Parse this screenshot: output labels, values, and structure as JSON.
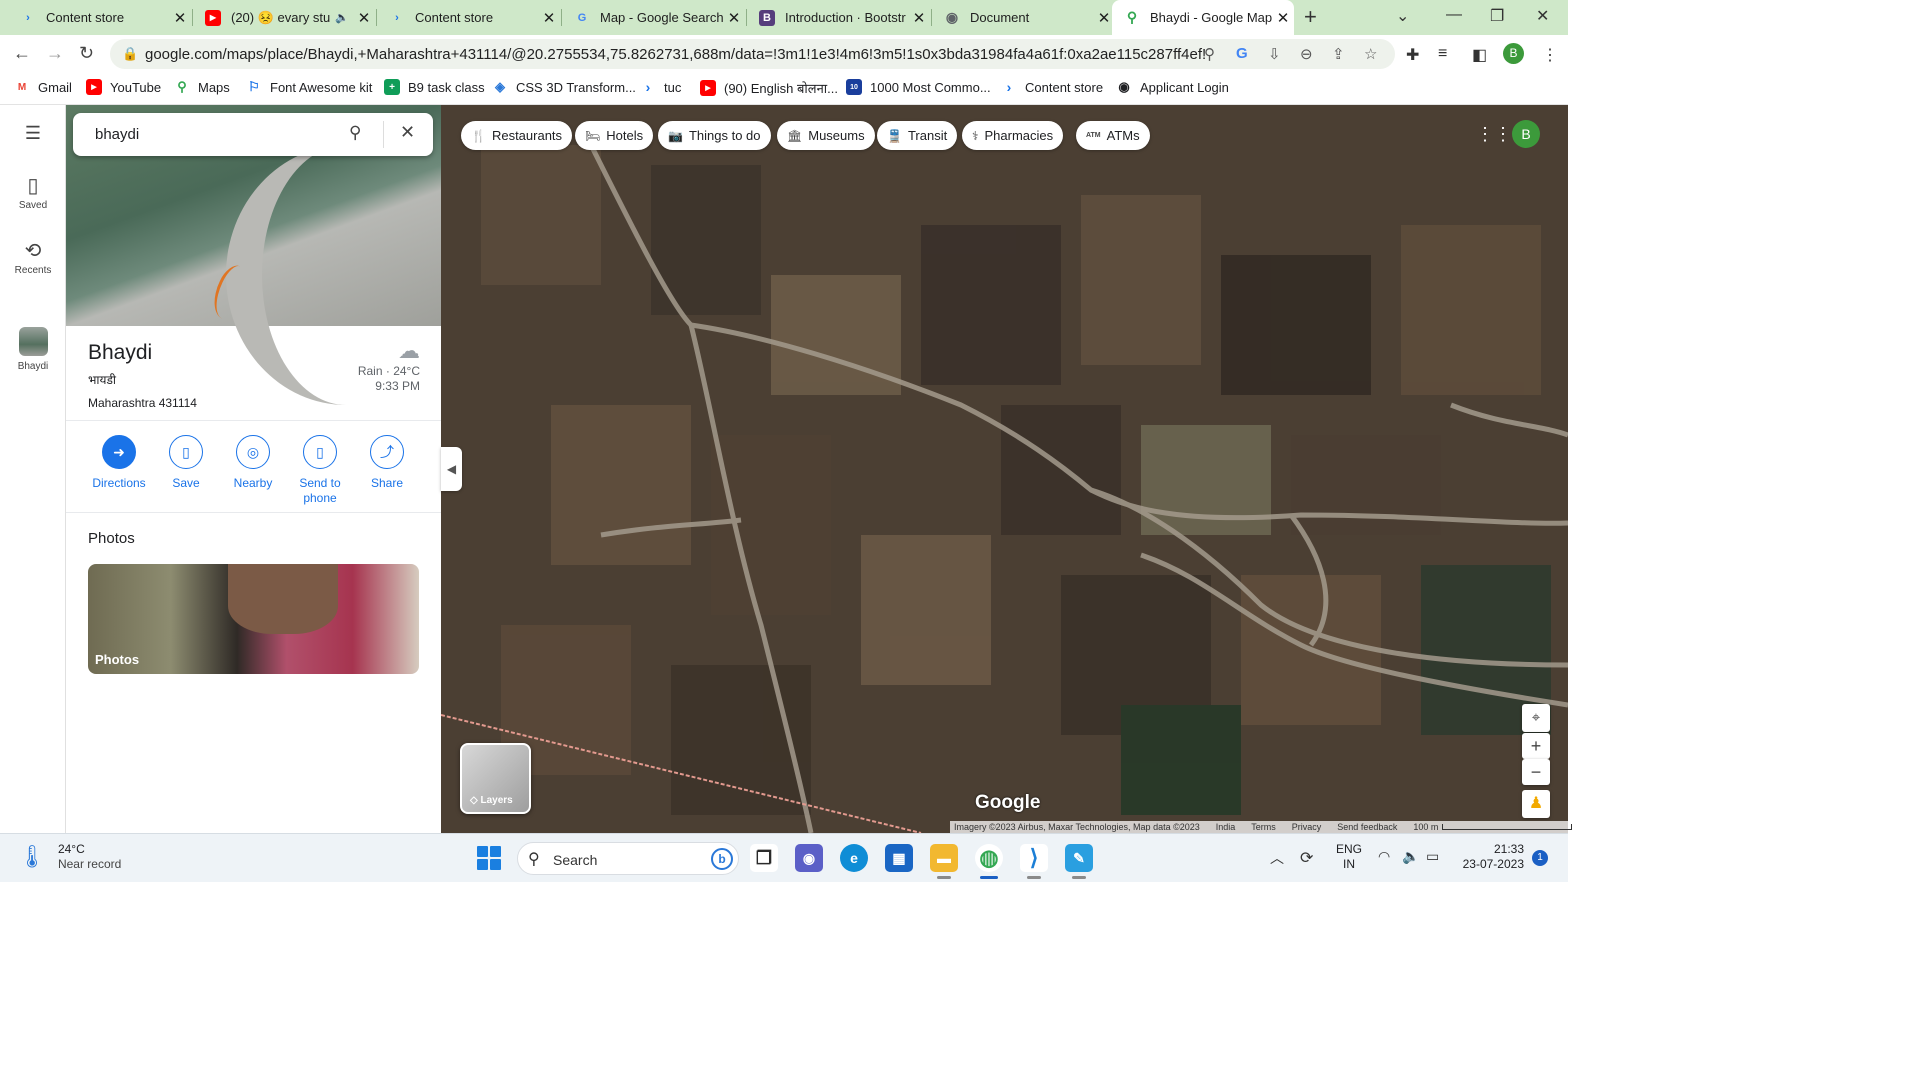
{
  "browser": {
    "tabs": [
      {
        "title": "Content store",
        "favicon": "content-store-icon",
        "color": "#1a73e8"
      },
      {
        "title": "(20) 😣 evary stu",
        "favicon": "youtube-icon",
        "color": "#ff0000",
        "audio": "🔈"
      },
      {
        "title": "Content store",
        "favicon": "content-store-icon",
        "color": "#1a73e8"
      },
      {
        "title": "Map - Google Search",
        "favicon": "google-icon",
        "color": "#4285f4"
      },
      {
        "title": "Introduction · Bootstr",
        "favicon": "bootstrap-icon",
        "color": "#563d7c"
      },
      {
        "title": "Document",
        "favicon": "globe-icon",
        "color": "#5f6368"
      },
      {
        "title": "Bhaydi - Google Map",
        "favicon": "google-maps-icon",
        "color": "#34a853"
      }
    ],
    "new_tab": "+",
    "url": "google.com/maps/place/Bhaydi,+Maharashtra+431114/@20.2755534,75.8262731,688m/data=!3m1!1e3!4m6!3m5!1s0x3bda31984fa4a61f:0xa2ae115c287ff4ef!8m2!...",
    "profile_initial": "B",
    "bookmarks": [
      {
        "label": "Gmail",
        "icon": "gmail-icon",
        "color": "#ea4335",
        "glyph": "M"
      },
      {
        "label": "YouTube",
        "icon": "youtube-icon",
        "color": "#ff0000",
        "glyph": "▶"
      },
      {
        "label": "Maps",
        "icon": "maps-icon",
        "color": "#34a853",
        "glyph": "⚲"
      },
      {
        "label": "Font Awesome kit",
        "icon": "flag-icon",
        "color": "#1a73e8",
        "glyph": "⚐"
      },
      {
        "label": "B9 task class",
        "icon": "plus-square-icon",
        "color": "#0f9d58",
        "glyph": "+"
      },
      {
        "label": "CSS 3D Transform...",
        "icon": "layers-icon",
        "color": "#2a78d8",
        "glyph": "◈"
      },
      {
        "label": "tuc",
        "icon": "content-store-icon",
        "color": "#1a73e8",
        "glyph": "›"
      },
      {
        "label": "(90) English बोलना...",
        "icon": "youtube-icon",
        "color": "#ff0000",
        "glyph": "▶"
      },
      {
        "label": "1000 Most Commo...",
        "icon": "calendar-icon",
        "color": "#1a3e9c",
        "glyph": "10"
      },
      {
        "label": "Content store",
        "icon": "content-store-icon",
        "color": "#1a73e8",
        "glyph": "›"
      },
      {
        "label": "Applicant Login",
        "icon": "globe-icon",
        "color": "#202124",
        "glyph": "◉"
      }
    ]
  },
  "maps": {
    "rail": [
      {
        "label": "Saved",
        "icon": "bookmark-icon",
        "glyph": "🔖"
      },
      {
        "label": "Recents",
        "icon": "history-icon",
        "glyph": "⟲"
      },
      {
        "label": "Bhaydi",
        "icon": "place-thumbnail"
      }
    ],
    "search": {
      "value": "bhaydi"
    },
    "place": {
      "name": "Bhaydi",
      "local_name": "भायडी",
      "address": "Maharashtra 431114",
      "weather": {
        "condition": "Rain · 24°C",
        "time": "9:33 PM",
        "icon": "rain-cloud-icon"
      }
    },
    "actions": [
      {
        "label": "Directions",
        "icon": "directions-icon",
        "glyph": "➜"
      },
      {
        "label": "Save",
        "icon": "bookmark-icon",
        "glyph": "🔖"
      },
      {
        "label": "Nearby",
        "icon": "nearby-icon",
        "glyph": "◎"
      },
      {
        "label": "Send to phone",
        "icon": "send-to-phone-icon",
        "glyph": "▯"
      },
      {
        "label": "Share",
        "icon": "share-icon",
        "glyph": "⤴"
      }
    ],
    "photos_heading": "Photos",
    "photos_label": "Photos",
    "chips": [
      {
        "label": "Restaurants",
        "icon": "restaurant-icon",
        "glyph": "🍴"
      },
      {
        "label": "Hotels",
        "icon": "hotel-icon",
        "glyph": "🛏"
      },
      {
        "label": "Things to do",
        "icon": "camera-icon",
        "glyph": "📷"
      },
      {
        "label": "Museums",
        "icon": "museum-icon",
        "glyph": "🏛"
      },
      {
        "label": "Transit",
        "icon": "transit-icon",
        "glyph": "🚆"
      },
      {
        "label": "Pharmacies",
        "icon": "pharmacy-icon",
        "glyph": "⚕"
      },
      {
        "label": "ATMs",
        "icon": "atm-icon",
        "glyph": "ATM"
      }
    ],
    "layers_label": "Layers",
    "logo": "Google",
    "attribution": {
      "imagery": "Imagery ©2023 Airbus, Maxar Technologies, Map data ©2023",
      "country": "India",
      "terms": "Terms",
      "privacy": "Privacy",
      "feedback": "Send feedback",
      "scale": "100 m"
    }
  },
  "taskbar": {
    "weather_temp": "24°C",
    "weather_desc": "Near record",
    "search_placeholder": "Search",
    "apps": [
      {
        "name": "task-view",
        "glyph": "❐",
        "color": "#2b2b2b"
      },
      {
        "name": "teams",
        "glyph": "◉",
        "color": "#5b5fc7"
      },
      {
        "name": "edge",
        "glyph": "e",
        "color": "#0f8dd6"
      },
      {
        "name": "store",
        "glyph": "▦",
        "color": "#1a66c4"
      },
      {
        "name": "file-explorer",
        "glyph": "▬",
        "color": "#f2b830"
      },
      {
        "name": "chrome",
        "glyph": "◍",
        "color": "#34a853"
      },
      {
        "name": "vscode",
        "glyph": "⟩",
        "color": "#1c7fd6"
      },
      {
        "name": "paint",
        "glyph": "✎",
        "color": "#2a9fe0"
      }
    ],
    "lang": "ENG",
    "region": "IN",
    "time": "21:33",
    "date": "23-07-2023",
    "notifications": "1"
  },
  "colors": {
    "accent": "#1a73e8",
    "tabbar": "#cfe8c9"
  }
}
